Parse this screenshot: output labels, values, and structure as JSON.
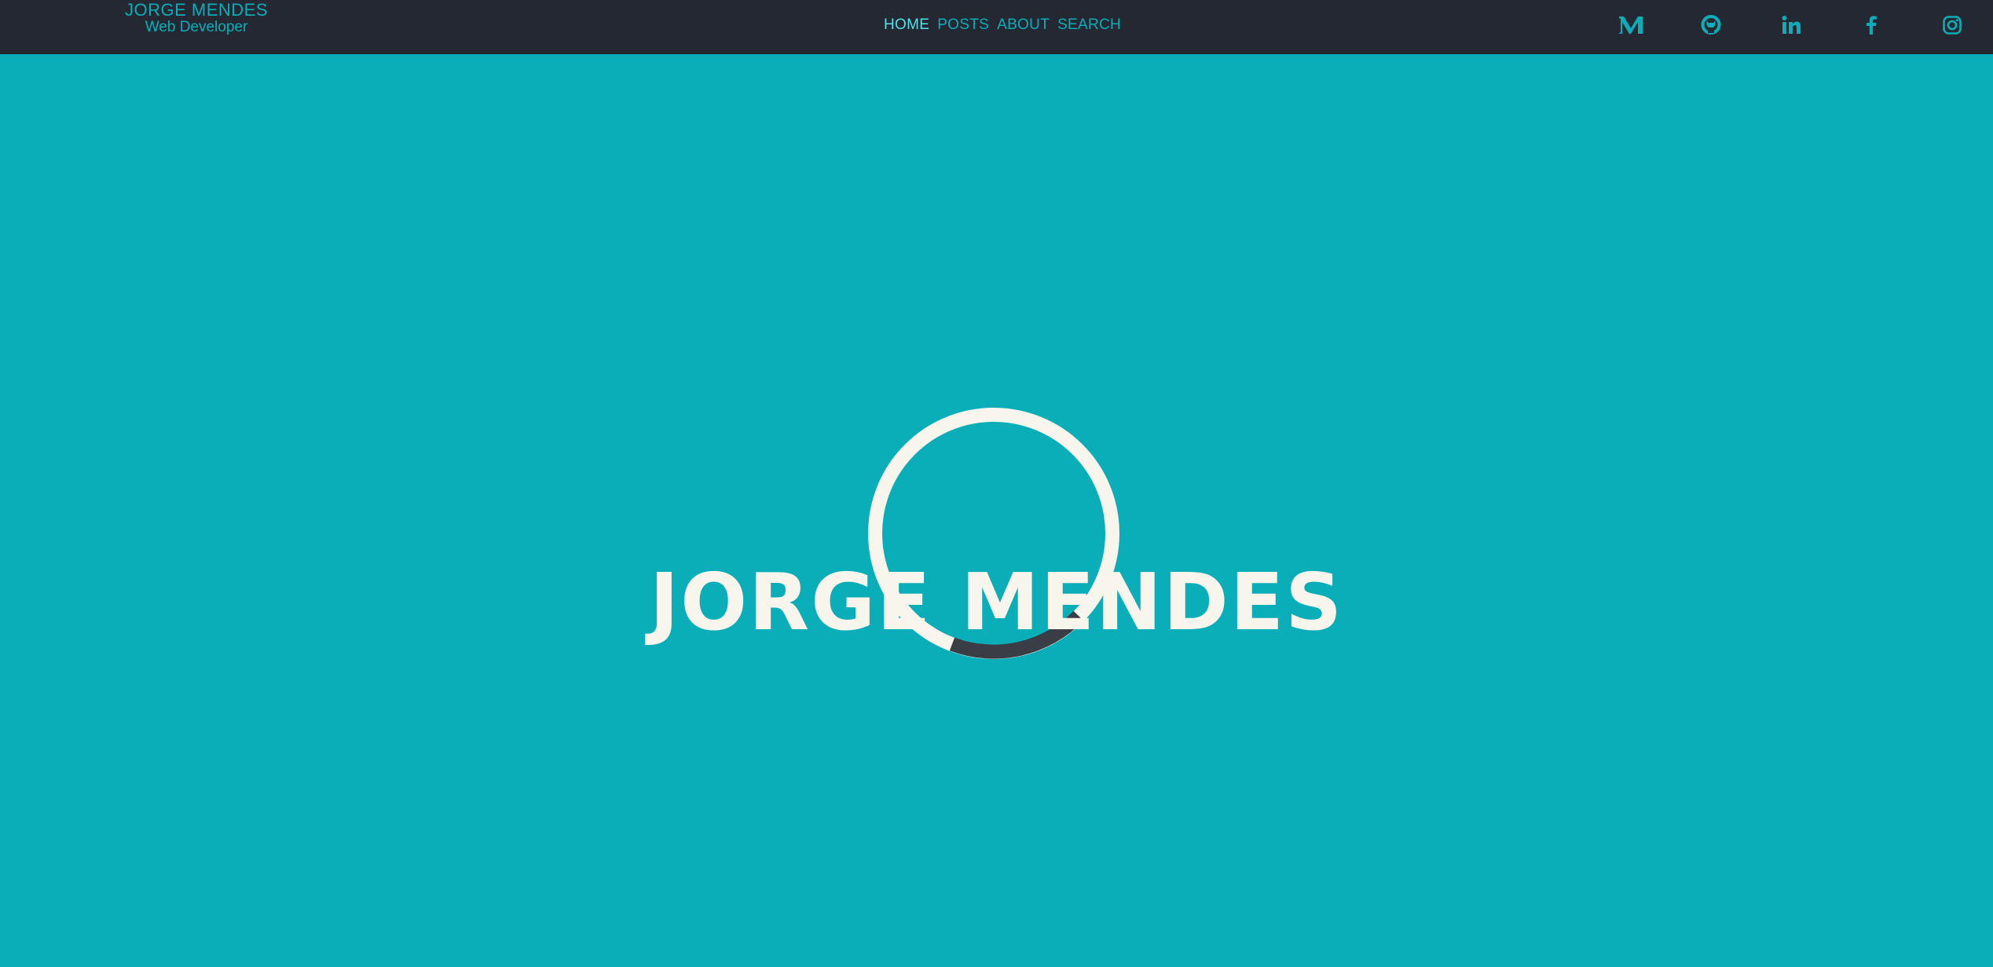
{
  "header": {
    "brand_name": "JORGE MENDES",
    "brand_subtitle": "Web Developer",
    "nav": [
      {
        "label": "HOME",
        "active": true
      },
      {
        "label": "POSTS",
        "active": false
      },
      {
        "label": "ABOUT",
        "active": false
      },
      {
        "label": "SEARCH",
        "active": false
      }
    ],
    "social": [
      {
        "icon": "medium-icon"
      },
      {
        "icon": "github-icon"
      },
      {
        "icon": "linkedin-icon"
      },
      {
        "icon": "facebook-icon"
      },
      {
        "icon": "instagram-icon"
      }
    ]
  },
  "hero": {
    "title": "JORGE MENDES"
  },
  "colors": {
    "accent": "#09aeb8",
    "navbar": "#232833",
    "text_light": "#f8f5ec",
    "loader_dark": "#3a3d45"
  }
}
